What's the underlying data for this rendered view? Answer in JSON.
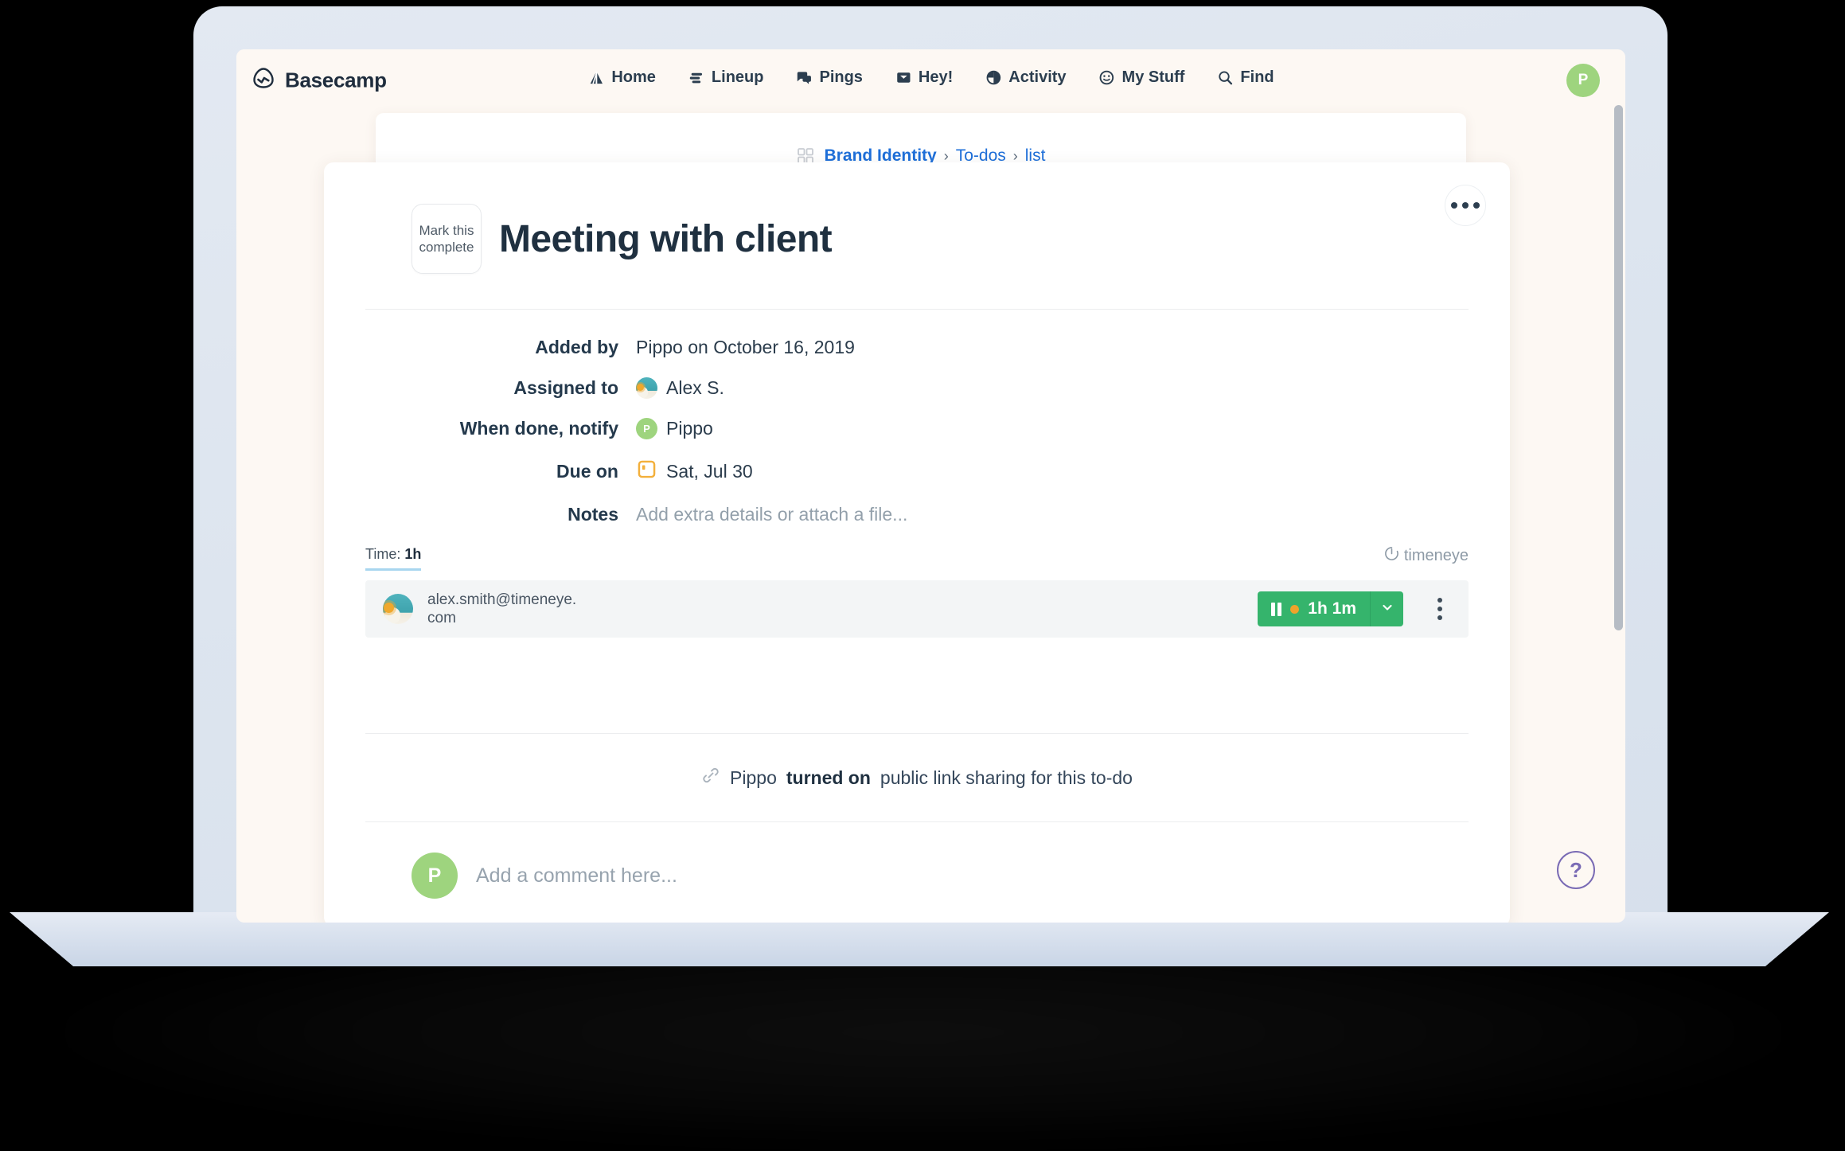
{
  "app": {
    "brand": "Basecamp",
    "brand_icon": "basecamp-logo-icon",
    "nav": [
      {
        "label": "Home",
        "icon": "home-tent-icon"
      },
      {
        "label": "Lineup",
        "icon": "lineup-bars-icon"
      },
      {
        "label": "Pings",
        "icon": "chat-bubbles-icon"
      },
      {
        "label": "Hey!",
        "icon": "inbox-tray-icon"
      },
      {
        "label": "Activity",
        "icon": "pie-clock-icon"
      },
      {
        "label": "My Stuff",
        "icon": "smiley-face-icon"
      },
      {
        "label": "Find",
        "icon": "search-icon"
      }
    ],
    "account_avatar_initial": "P"
  },
  "breadcrumb": {
    "project": "Brand Identity",
    "section": "To-dos",
    "list": "list",
    "separator": "›",
    "grid_icon": "grid-squares-icon"
  },
  "todo": {
    "mark_complete_line1": "Mark this",
    "mark_complete_line2": "complete",
    "title": "Meeting with client",
    "overflow_icon": "ellipsis-icon",
    "fields": [
      {
        "label": "Added by",
        "value": "Pippo on October 16, 2019",
        "avatar": "none",
        "muted": false
      },
      {
        "label": "Assigned to",
        "value": "Alex S.",
        "avatar": "photo",
        "muted": false
      },
      {
        "label": "When done, notify",
        "value": "Pippo",
        "avatar": "letter",
        "avatar_initial": "P",
        "muted": false
      },
      {
        "label": "Due on",
        "value": "Sat, Jul 30",
        "avatar": "calendar",
        "muted": false
      },
      {
        "label": "Notes",
        "value": "Add extra details or attach a file...",
        "avatar": "none",
        "muted": true
      }
    ]
  },
  "timeneye": {
    "time_label": "Time:",
    "time_value": "1h",
    "logo_text": "timeneye",
    "logo_icon": "timeneye-circle-icon",
    "entry_email_line1": "alex.smith@timeneye.",
    "entry_email_line2": "com",
    "entry_avatar": "photo",
    "timer": {
      "state_icon": "pause-icon",
      "running_dot": true,
      "elapsed": "1h 1m",
      "caret_icon": "chevron-down-icon",
      "color": "#35b46c"
    },
    "kebab_icon": "vertical-ellipsis-icon"
  },
  "activity": {
    "icon": "link-chain-icon",
    "actor": "Pippo",
    "action": "turned on",
    "rest": "public link sharing for this to-do"
  },
  "comment": {
    "avatar_initial": "P",
    "placeholder": "Add a comment here..."
  },
  "help": {
    "icon": "question-mark-icon",
    "label": "?",
    "color": "#7a6bb5"
  },
  "colors": {
    "brand_dark": "#1f2d3d",
    "link_blue": "#1e6fd9",
    "avatar_green": "#9ed47e",
    "timer_green": "#35b46c",
    "running_orange": "#efa32b",
    "screen_bg": "#fdf8f3",
    "lid": "#dde5ef"
  }
}
